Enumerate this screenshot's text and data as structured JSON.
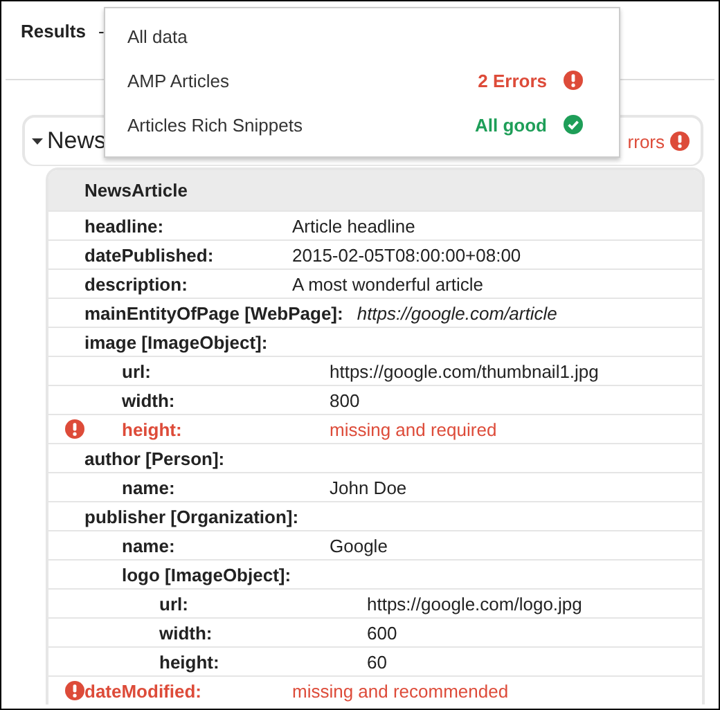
{
  "header": {
    "title": "Results",
    "separator": "-"
  },
  "menu": {
    "items": [
      {
        "label": "All data"
      },
      {
        "label": "AMP Articles",
        "status": {
          "text": "2 Errors",
          "kind": "error"
        }
      },
      {
        "label": "Articles Rich Snippets",
        "status": {
          "text": "All good",
          "kind": "ok"
        }
      }
    ]
  },
  "card": {
    "title": "News",
    "expanded": true,
    "status": {
      "text": "rrors",
      "kind": "error"
    }
  },
  "table": {
    "title": "NewsArticle",
    "rows": [
      {
        "kind": "field",
        "key": "headline:",
        "value": "Article headline"
      },
      {
        "kind": "field",
        "key": "datePublished:",
        "value": "2015-02-05T08:00:00+08:00"
      },
      {
        "kind": "field",
        "key": "description:",
        "value": "A most wonderful article"
      },
      {
        "kind": "link",
        "key": "mainEntityOfPage [WebPage]:",
        "value": "https://google.com/article"
      },
      {
        "kind": "field",
        "key": "image [ImageObject]:",
        "children": [
          {
            "kind": "field",
            "key": "url:",
            "value": "https://google.com/thumbnail1.jpg"
          },
          {
            "kind": "field",
            "key": "width:",
            "value": "800"
          },
          {
            "kind": "error",
            "key": "height:",
            "value": "missing and required"
          }
        ]
      },
      {
        "kind": "field",
        "key": "author [Person]:",
        "children": [
          {
            "kind": "field",
            "key": "name:",
            "value": "John Doe"
          }
        ]
      },
      {
        "kind": "field",
        "key": "publisher [Organization]:",
        "children": [
          {
            "kind": "field",
            "key": "name:",
            "value": "Google"
          },
          {
            "kind": "field",
            "key": "logo [ImageObject]:",
            "children": [
              {
                "kind": "field",
                "key": "url:",
                "value": "https://google.com/logo.jpg"
              },
              {
                "kind": "field",
                "key": "width:",
                "value": "600"
              },
              {
                "kind": "field",
                "key": "height:",
                "value": "60"
              }
            ]
          }
        ]
      },
      {
        "kind": "error",
        "key": "dateModified:",
        "value": "missing and recommended"
      }
    ]
  }
}
